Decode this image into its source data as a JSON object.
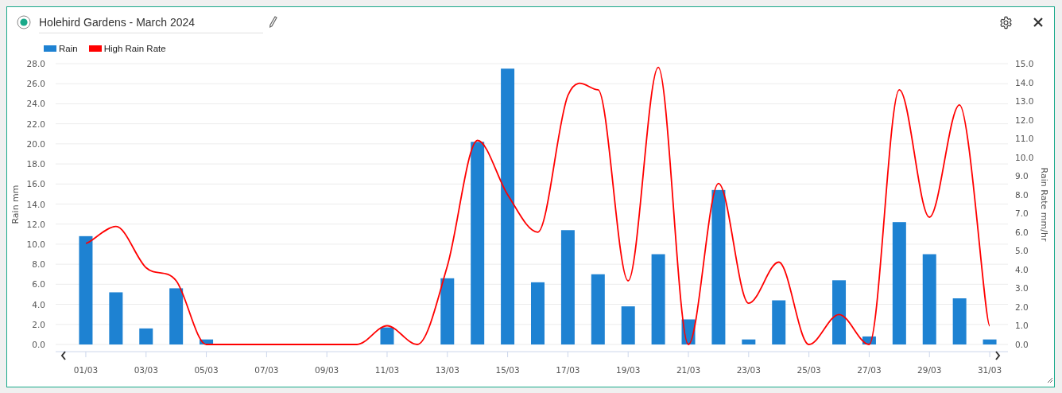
{
  "widget": {
    "title": "Holehird Gardens - March 2024"
  },
  "chart_data": {
    "type": "bar",
    "ylabel": "Rain mm",
    "y2label": "Rain Rate mm/hr",
    "categories": [
      "01/03",
      null,
      "03/03",
      null,
      "05/03",
      null,
      "07/03",
      null,
      "09/03",
      null,
      "11/03",
      null,
      "13/03",
      null,
      "15/03",
      null,
      "17/03",
      null,
      "19/03",
      null,
      "21/03",
      null,
      "23/03",
      null,
      "25/03",
      null,
      "27/03",
      null,
      "29/03",
      null,
      "31/03"
    ],
    "series": [
      {
        "name": "Rain",
        "color": "#1e82d2",
        "values": [
          10.8,
          5.2,
          1.6,
          5.6,
          0.5,
          0,
          0,
          0,
          0,
          0,
          1.7,
          0,
          6.6,
          20.2,
          27.5,
          6.2,
          11.4,
          7.0,
          3.8,
          9.0,
          2.5,
          15.4,
          0.5,
          4.4,
          0,
          6.4,
          0.8,
          12.2,
          9.0,
          4.6,
          0.5
        ]
      },
      {
        "name": "High Rain Rate",
        "type": "line",
        "axis": "y2",
        "color": "#ff0000",
        "values": [
          5.4,
          6.3,
          4.1,
          3.4,
          0,
          0,
          0,
          0,
          0,
          0,
          1.0,
          0,
          4.2,
          10.9,
          8.0,
          6.0,
          13.3,
          13.6,
          3.4,
          14.8,
          0,
          8.6,
          2.2,
          4.4,
          0,
          1.6,
          0,
          13.6,
          6.8,
          12.8,
          1.0
        ]
      }
    ],
    "grid": true,
    "ylim": [
      0,
      28
    ],
    "y2lim": [
      0,
      15
    ],
    "yticks": [
      {
        "value": 0,
        "label": "0.0"
      },
      {
        "value": 2,
        "label": "2.0"
      },
      {
        "value": 4,
        "label": "4.0"
      },
      {
        "value": 6,
        "label": "6.0"
      },
      {
        "value": 8,
        "label": "8.0"
      },
      {
        "value": 10,
        "label": "10.0"
      },
      {
        "value": 12,
        "label": "12.0"
      },
      {
        "value": 14,
        "label": "14.0"
      },
      {
        "value": 16,
        "label": "16.0"
      },
      {
        "value": 18,
        "label": "18.0"
      },
      {
        "value": 20,
        "label": "20.0"
      },
      {
        "value": 22,
        "label": "22.0"
      },
      {
        "value": 24,
        "label": "24.0"
      },
      {
        "value": 26,
        "label": "26.0"
      },
      {
        "value": 28,
        "label": "28.0"
      }
    ],
    "y2ticks": [
      {
        "value": 0,
        "label": "0.0"
      },
      {
        "value": 1,
        "label": "1.0"
      },
      {
        "value": 2,
        "label": "2.0"
      },
      {
        "value": 3,
        "label": "3.0"
      },
      {
        "value": 4,
        "label": "4.0"
      },
      {
        "value": 5,
        "label": "5.0"
      },
      {
        "value": 6,
        "label": "6.0"
      },
      {
        "value": 7,
        "label": "7.0"
      },
      {
        "value": 8,
        "label": "8.0"
      },
      {
        "value": 9,
        "label": "9.0"
      },
      {
        "value": 10,
        "label": "10.0"
      },
      {
        "value": 11,
        "label": "11.0"
      },
      {
        "value": 12,
        "label": "12.0"
      },
      {
        "value": 13,
        "label": "13.0"
      },
      {
        "value": 14,
        "label": "14.0"
      },
      {
        "value": 15,
        "label": "15.0"
      }
    ]
  }
}
